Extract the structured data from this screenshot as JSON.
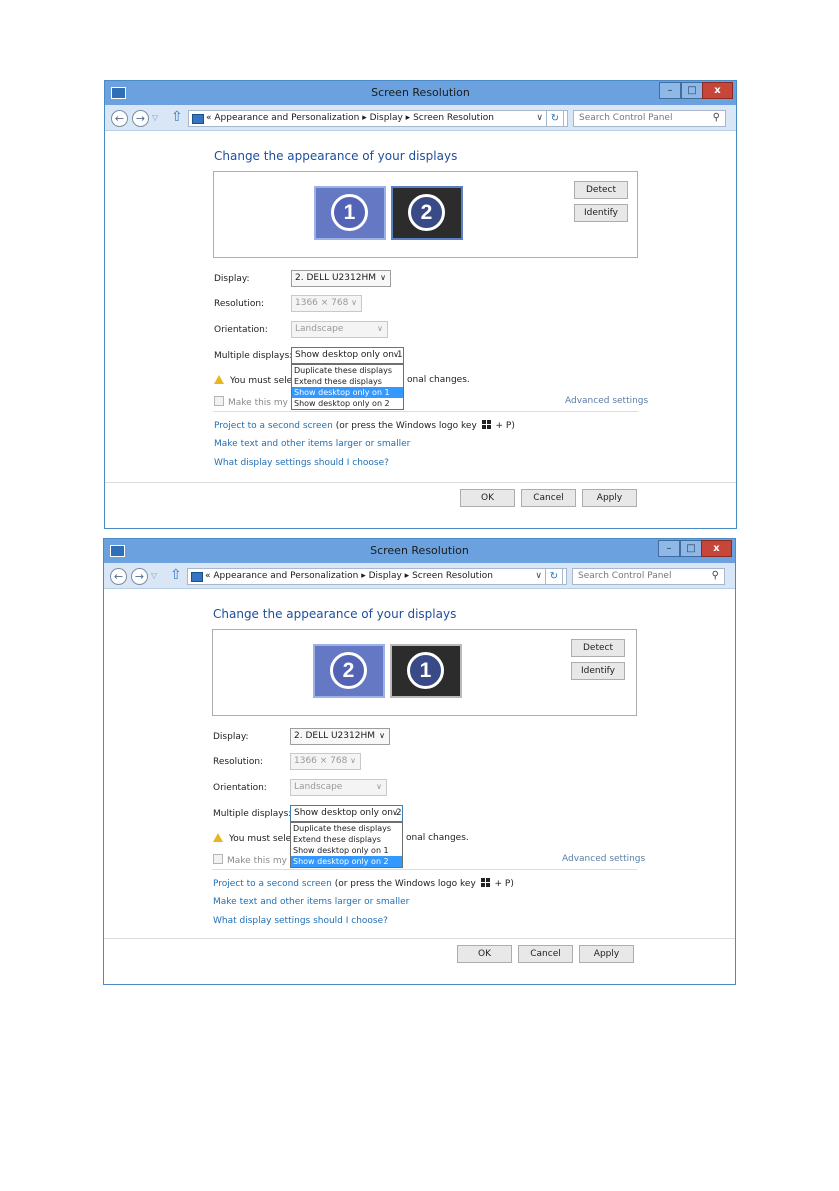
{
  "windows": [
    {
      "title": "Screen Resolution",
      "caption": {
        "minimize": "–",
        "maximize": "□",
        "close": "x"
      },
      "nav": {
        "back": "←",
        "forward": "→",
        "recent": "▽",
        "up": "⇧"
      },
      "breadcrumb": {
        "prefix": "«",
        "items": [
          "Appearance and Personalization",
          "Display",
          "Screen Resolution"
        ],
        "separator": "▸"
      },
      "address_dropdown": "∨",
      "refresh": "↻",
      "search": {
        "placeholder": "Search Control Panel",
        "icon": "search-icon"
      },
      "heading": "Change the appearance of your displays",
      "monitors": [
        {
          "number": "1",
          "selected": false
        },
        {
          "number": "2",
          "selected": true
        }
      ],
      "detect_label": "Detect",
      "identify_label": "Identify",
      "display_label": "Display:",
      "display_value": "2. DELL U2312HM",
      "resolution_label": "Resolution:",
      "resolution_value": "1366 × 768",
      "orientation_label": "Orientation:",
      "orientation_value": "Landscape",
      "multiple_label": "Multiple displays:",
      "multiple_value": "Show desktop only on 1",
      "dropdown_options": [
        "Duplicate these displays",
        "Extend these displays",
        "Show desktop only on 1",
        "Show desktop only on 2"
      ],
      "dropdown_selected_index": 2,
      "warning_lead": "You must selec",
      "warning_tail": "onal changes.",
      "checkbox_label": "Make this my ma",
      "advanced_link": "Advanced settings",
      "project_link": "Project to a second screen",
      "project_suffix_a": "(or press the Windows logo key",
      "project_suffix_b": "+ P)",
      "text_size_link": "Make text and other items larger or smaller",
      "help_link": "What display settings should I choose?",
      "ok_label": "OK",
      "cancel_label": "Cancel",
      "apply_label": "Apply"
    },
    {
      "title": "Screen Resolution",
      "caption": {
        "minimize": "–",
        "maximize": "□",
        "close": "x"
      },
      "nav": {
        "back": "←",
        "forward": "→",
        "recent": "▽",
        "up": "⇧"
      },
      "breadcrumb": {
        "prefix": "«",
        "items": [
          "Appearance and Personalization",
          "Display",
          "Screen Resolution"
        ],
        "separator": "▸"
      },
      "address_dropdown": "∨",
      "refresh": "↻",
      "search": {
        "placeholder": "Search Control Panel",
        "icon": "search-icon"
      },
      "heading": "Change the appearance of your displays",
      "monitors": [
        {
          "number": "2",
          "selected": true
        },
        {
          "number": "1",
          "selected": false
        }
      ],
      "detect_label": "Detect",
      "identify_label": "Identify",
      "display_label": "Display:",
      "display_value": "2. DELL U2312HM",
      "resolution_label": "Resolution:",
      "resolution_value": "1366 × 768",
      "orientation_label": "Orientation:",
      "orientation_value": "Landscape",
      "multiple_label": "Multiple displays:",
      "multiple_value": "Show desktop only on 2",
      "dropdown_options": [
        "Duplicate these displays",
        "Extend these displays",
        "Show desktop only on 1",
        "Show desktop only on 2"
      ],
      "dropdown_selected_index": 3,
      "warning_lead": "You must selec",
      "warning_tail": "onal changes.",
      "checkbox_label": "Make this my ma",
      "advanced_link": "Advanced settings",
      "project_link": "Project to a second screen",
      "project_suffix_a": "(or press the Windows logo key",
      "project_suffix_b": "+ P)",
      "text_size_link": "Make text and other items larger or smaller",
      "help_link": "What display settings should I choose?",
      "ok_label": "OK",
      "cancel_label": "Cancel",
      "apply_label": "Apply"
    }
  ],
  "colors": {
    "titlebar": "#6aa1de",
    "link": "#1f6fb6",
    "selection": "#3399ff",
    "heading": "#1f4e9c"
  }
}
